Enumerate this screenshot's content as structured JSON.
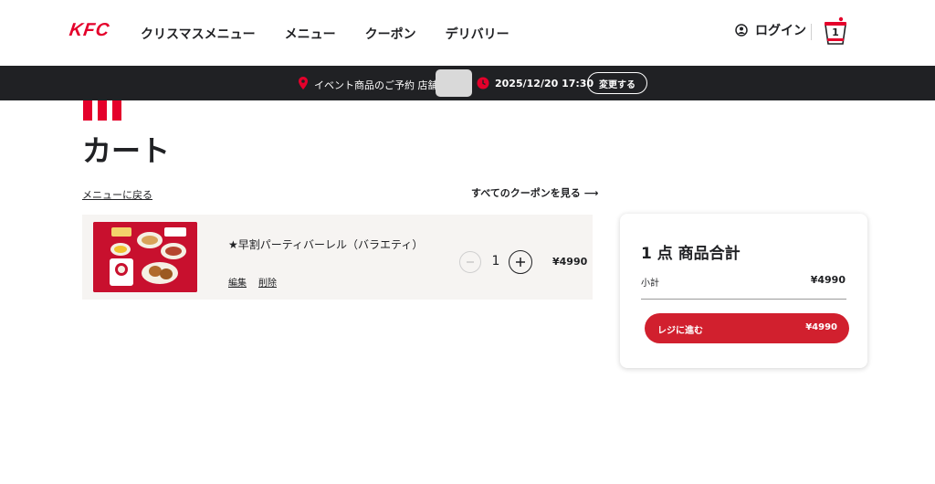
{
  "header": {
    "logo": "KFC",
    "nav": [
      "クリスマスメニュー",
      "メニュー",
      "クーポン",
      "デリバリー"
    ],
    "login_label": "ログイン",
    "cart_count": "1"
  },
  "event_bar": {
    "label": "イベント商品のご予約 店舗:",
    "datetime": "2025/12/20 17:30",
    "change_label": "変更する"
  },
  "page": {
    "title": "カート",
    "back_link": "メニューに戻る",
    "coupons_link": "すべてのクーポンを見る",
    "coupons_arrow": "⟶"
  },
  "cart": {
    "items": [
      {
        "name": "★早割パーティバーレル（バラエティ）",
        "edit_label": "編集",
        "delete_label": "削除",
        "quantity": "1",
        "price": "¥4990"
      }
    ]
  },
  "summary": {
    "title": "1 点 商品合計",
    "subtotal_label": "小計",
    "subtotal_value": "¥4990",
    "checkout_label": "レジに進む",
    "checkout_price": "¥4990"
  },
  "colors": {
    "brand_red": "#e4002b",
    "checkout_red": "#d1202e",
    "event_bar_bg": "#202124"
  },
  "icons": {
    "user": "user-icon",
    "cart": "bucket-icon",
    "pin": "location-pin-icon",
    "clock": "clock-icon",
    "minus": "minus-icon",
    "plus": "plus-icon"
  }
}
